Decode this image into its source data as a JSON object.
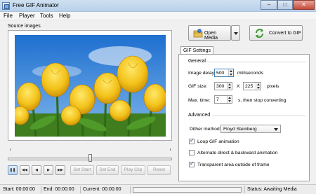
{
  "window": {
    "title": "Free GIF Animator",
    "controls": {
      "minimize": "–",
      "maximize": "□",
      "close": "✕"
    }
  },
  "menu": [
    "File",
    "Player",
    "Tools",
    "Help"
  ],
  "source": {
    "label": "Source images",
    "image_icon": "tulips-photo"
  },
  "player": {
    "seek_position": 0.5,
    "buttons": {
      "pause": "❚❚",
      "first": "◀◀",
      "prev": "◀",
      "next": "▶",
      "last": "▶▶",
      "set_start": "Set Start",
      "set_end": "Set End",
      "play_clip": "Play Clip",
      "reset": "Reset"
    }
  },
  "actions": {
    "open_media": "Open Media",
    "convert": "Convert to GIF",
    "open_icon": "folder-icon",
    "convert_icon": "convert-arrows-icon"
  },
  "settings": {
    "tab": "GIF Settings",
    "general": {
      "title": "General",
      "image_delay_label": "Image delay:",
      "image_delay_value": "500",
      "image_delay_unit": "milliseconds",
      "gif_size_label": "GIF size:",
      "width": "300",
      "size_x": "X",
      "height": "225",
      "size_unit": "pixels",
      "max_time_label": "Max. time:",
      "max_time_value": "7",
      "max_time_unit": "s, then stop converting"
    },
    "advanced": {
      "title": "Advanced",
      "dither_label": "Dither method:",
      "dither_value": "Floyd Steinberg",
      "loop_label": "Loop GIF animation",
      "loop_checked": true,
      "alternate_label": "Alternate direct & backward animation",
      "alternate_checked": false,
      "transparent_label": "Transparent area outside of frame",
      "transparent_checked": true
    }
  },
  "status": {
    "start": "Start: 00:00:00",
    "end": "End: 00:00:00",
    "current": "Current: 00:00:00",
    "progress": 0,
    "status": "Status: Awaiting Media"
  }
}
